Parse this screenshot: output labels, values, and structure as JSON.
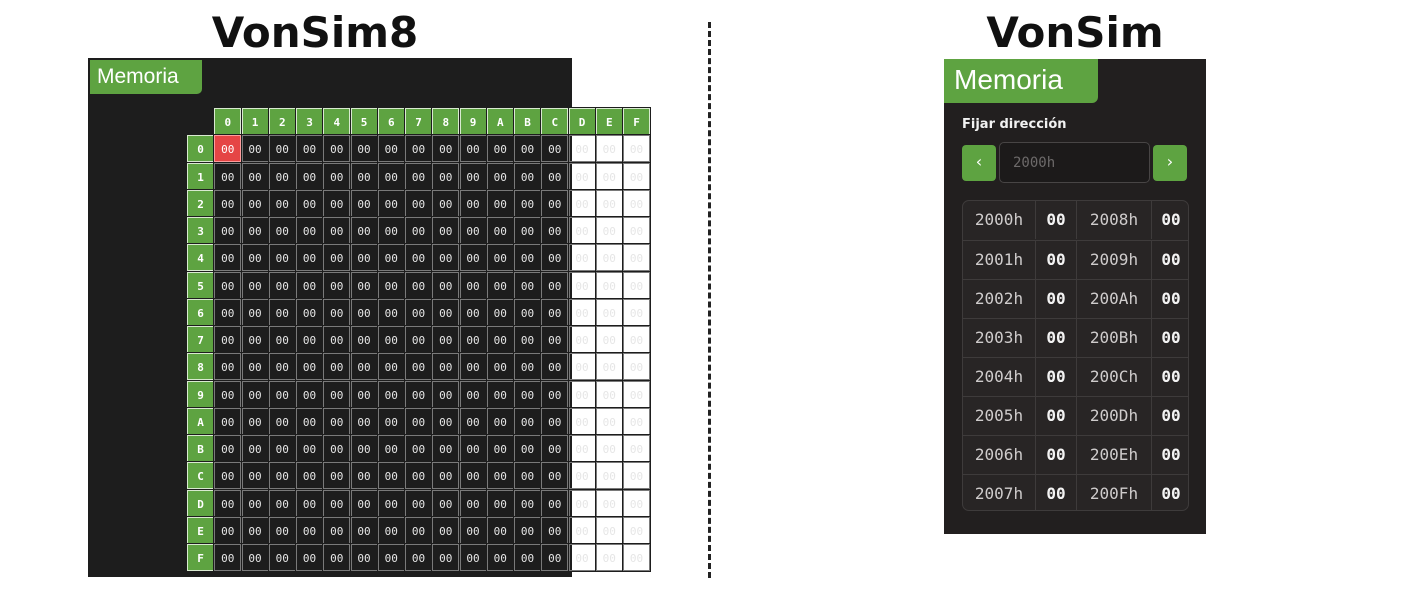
{
  "left_title": "VonSim8",
  "right_title": "VonSim",
  "vonsim8": {
    "tab_label": "Memoria",
    "column_headers": [
      "0",
      "1",
      "2",
      "3",
      "4",
      "5",
      "6",
      "7",
      "8",
      "9",
      "A",
      "B",
      "C",
      "D",
      "E",
      "F"
    ],
    "row_headers": [
      "0",
      "1",
      "2",
      "3",
      "4",
      "5",
      "6",
      "7",
      "8",
      "9",
      "A",
      "B",
      "C",
      "D",
      "E",
      "F"
    ],
    "cell_value": "00",
    "selected_cell": "0,0",
    "selected_color": "#e54545",
    "accent_color": "#5ea341"
  },
  "vonsim": {
    "tab_label": "Memoria",
    "fijar_label": "Fijar dirección",
    "prev_icon": "‹",
    "next_icon": "›",
    "address_placeholder": "2000h",
    "rows": [
      {
        "addr1": "2000h",
        "val1": "00",
        "addr2": "2008h",
        "val2": "00"
      },
      {
        "addr1": "2001h",
        "val1": "00",
        "addr2": "2009h",
        "val2": "00"
      },
      {
        "addr1": "2002h",
        "val1": "00",
        "addr2": "200Ah",
        "val2": "00"
      },
      {
        "addr1": "2003h",
        "val1": "00",
        "addr2": "200Bh",
        "val2": "00"
      },
      {
        "addr1": "2004h",
        "val1": "00",
        "addr2": "200Ch",
        "val2": "00"
      },
      {
        "addr1": "2005h",
        "val1": "00",
        "addr2": "200Dh",
        "val2": "00"
      },
      {
        "addr1": "2006h",
        "val1": "00",
        "addr2": "200Eh",
        "val2": "00"
      },
      {
        "addr1": "2007h",
        "val1": "00",
        "addr2": "200Fh",
        "val2": "00"
      }
    ]
  }
}
